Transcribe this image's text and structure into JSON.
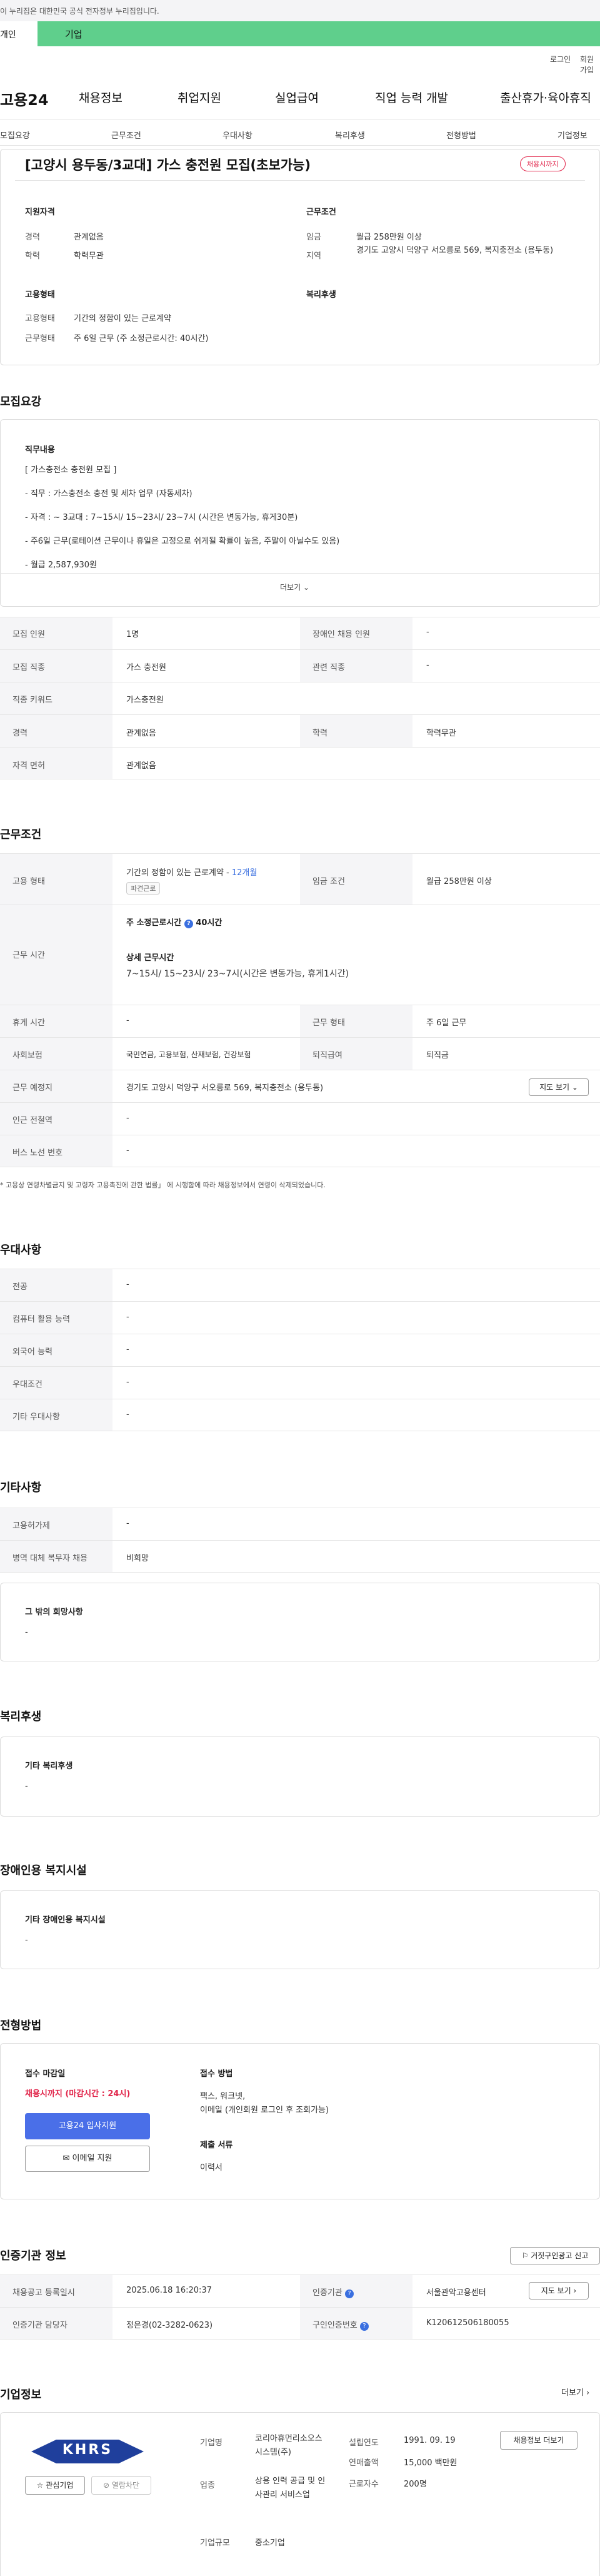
{
  "notice": "이 누리집은 대한민국 공식 전자정부 누리집입니다.",
  "gnb_tabs": [
    "개인",
    "기업"
  ],
  "util_links": [
    "로그인",
    "회원가입"
  ],
  "logo": "고용24",
  "main_nav": [
    "채용정보",
    "취업지원",
    "실업급여",
    "직업 능력 개발",
    "출산휴가·육아휴직"
  ],
  "sub_nav": [
    "모집요강",
    "근무조건",
    "우대사항",
    "복리후생",
    "전형방법",
    "기업정보"
  ],
  "job": {
    "title": "[고양시 용두동/3교대] 가스 충전원 모집(초보가능)",
    "badge": "채용시까지"
  },
  "summary": {
    "h_qual": "지원자격",
    "career_l": "경력",
    "career_v": "관계없음",
    "edu_l": "학력",
    "edu_v": "학력무관",
    "h_work": "근무조건",
    "wage_l": "임금",
    "wage_v": "월급 258만원 이상",
    "area_l": "지역",
    "area_v": "경기도 고양시 덕양구 서오릉로 569, 복지충전소 (용두동)",
    "h_emp": "고용형태",
    "emp_l": "고용형태",
    "emp_v": "기간의 정함이 있는 근로계약",
    "hours_l": "근무형태",
    "hours_v": "주 6일 근무 (주 소정근로시간: 40시간)",
    "h_welfare": "복리후생"
  },
  "recruit": {
    "title": "모집요강",
    "duty_h": "직무내용",
    "lines": [
      "[ 가스충전소 충전원 모집 ]",
      "- 직무 : 가스충전소 충전 및 세차 업무 (자동세차)",
      "- 자격 : ~ 3교대 : 7~15시/ 15~23시/ 23~7시 (시간은 변동가능, 휴게30분)",
      "- 주6일 근무(로테이션 근무이나 휴일은 고정으로 쉬게될 확률이 높음, 주말이 아닐수도 있음)",
      "- 월급 2,587,930원"
    ],
    "more": "더보기",
    "t": [
      [
        "모집 인원",
        "1명",
        "장애인 채용 인원",
        "-"
      ],
      [
        "모집 직종",
        "가스 충전원",
        "관련 직종",
        "-"
      ],
      [
        "직종 키워드",
        "가스충전원"
      ],
      [
        "경력",
        "관계없음",
        "학력",
        "학력무관"
      ],
      [
        "자격 면허",
        "관계없음"
      ]
    ]
  },
  "cond": {
    "title": "근무조건",
    "emp_l": "고용 형태",
    "emp_v": "기간의 정함이 있는 근로계약 -",
    "emp_period": "12개월",
    "emp_tag": "파견근로",
    "wage_l": "임금 조건",
    "wage_v": "월급 258만원 이상",
    "time_l": "근무 시간",
    "time_week": "주 소정근로시간",
    "time_week_v": "40시간",
    "time_detail_h": "상세 근무시간",
    "time_detail_v": "7~15시/ 15~23시/ 23~7시(시간은 변동가능, 휴게1시간)",
    "t": [
      [
        "휴게 시간",
        "-",
        "근무 형태",
        "주 6일 근무"
      ],
      [
        "사회보험",
        "국민연금, 고용보험, 산재보험, 건강보험",
        "퇴직급여",
        "퇴직금"
      ],
      [
        "근무 예정지",
        "경기도 고양시 덕양구 서오릉로 569, 복지충전소 (용두동)"
      ],
      [
        "인근 전철역",
        "-"
      ],
      [
        "버스 노선 번호",
        "-"
      ]
    ],
    "map_btn": "지도 보기",
    "note": "* 고용상 연령차별금지 및 고령자 고용촉진에 관한 법률」 에 시행함에 따라 채용정보에서 연령이 삭제되었습니다."
  },
  "pref": {
    "title": "우대사항",
    "t": [
      [
        "전공",
        "-"
      ],
      [
        "컴퓨터 활용 능력",
        "-"
      ],
      [
        "외국어 능력",
        "-"
      ],
      [
        "우대조건",
        "-"
      ],
      [
        "기타 우대사항",
        "-"
      ]
    ]
  },
  "etc": {
    "title": "기타사항",
    "t": [
      [
        "고용허가제",
        "-"
      ],
      [
        "병역 대체 복무자 채용",
        "비희망"
      ]
    ],
    "box_h": "그 밖의 희망사항",
    "box_v": "-"
  },
  "welfare": {
    "title": "복리후생",
    "box_h": "기타 복리후생",
    "box_v": "-"
  },
  "disabled": {
    "title": "장애인용 복지시설",
    "box_h": "기타 장애인용 복지시설",
    "box_v": "-"
  },
  "process": {
    "title": "전형방법",
    "deadline_h": "접수 마감일",
    "deadline_v": "채용시까지 (마감시간 : 24시)",
    "apply_btn": "고용24 입사지원",
    "email_btn": "이메일 지원",
    "method_h": "접수 방법",
    "method_v": [
      "팩스, 워크넷,",
      "이메일 (개인회원 로그인 후 조회가능)"
    ],
    "docs_h": "제출 서류",
    "docs_v": "이력서"
  },
  "agency": {
    "title": "인증기관 정보",
    "print_btn": "거짓구인광고 신고",
    "t": [
      [
        "채용공고 등록일시",
        "2025.06.18 16:20:37",
        "인증기관",
        "서울관악고용센터"
      ],
      [
        "인증기관 담당자",
        "정은경(02-3282-0623)",
        "구인인증번호",
        "K120612506180055"
      ]
    ],
    "map_btn": "지도 보기"
  },
  "company": {
    "title": "기업정보",
    "more": "더보기",
    "logo_text": "KHRS",
    "fav_btn": "관심기업",
    "block_btn": "열람차단",
    "recruit_btn": "채용정보 더보기",
    "name_l": "기업명",
    "name_v": "코리아휴먼리소오스시스템(주)",
    "ind_l": "업종",
    "ind_v": "상용 인력 공급 및 인사관리 서비스업",
    "size_l": "기업규모",
    "size_v": "중소기업",
    "est_l": "설립연도",
    "est_v": "1991. 09. 19",
    "sales_l": "연매출액",
    "sales_v": "15,000 백만원",
    "emp_l": "근로자수",
    "emp_v": "200명"
  }
}
